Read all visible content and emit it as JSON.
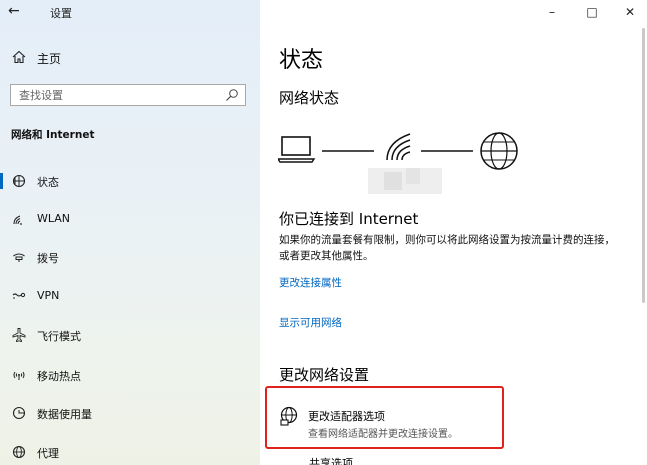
{
  "app": {
    "title": "设置"
  },
  "sidebar": {
    "home_label": "主页",
    "search_placeholder": "查找设置",
    "section_title": "网络和 Internet",
    "items": [
      {
        "label": "状态",
        "icon": "status-icon",
        "active": true
      },
      {
        "label": "WLAN",
        "icon": "wifi-icon",
        "active": false
      },
      {
        "label": "拨号",
        "icon": "dialup-icon",
        "active": false
      },
      {
        "label": "VPN",
        "icon": "vpn-icon",
        "active": false
      },
      {
        "label": "飞行模式",
        "icon": "airplane-icon",
        "active": false
      },
      {
        "label": "移动热点",
        "icon": "hotspot-icon",
        "active": false
      },
      {
        "label": "数据使用量",
        "icon": "data-usage-icon",
        "active": false
      },
      {
        "label": "代理",
        "icon": "globe-icon",
        "active": false
      }
    ]
  },
  "main": {
    "page_title": "状态",
    "network_status_heading": "网络状态",
    "connected_title": "你已连接到 Internet",
    "connected_desc": "如果你的流量套餐有限制，则你可以将此网络设置为按流量计费的连接，或者更改其他属性。",
    "link_change_props": "更改连接属性",
    "link_show_networks": "显示可用网络",
    "change_settings_heading": "更改网络设置",
    "adapter_title": "更改适配器选项",
    "adapter_desc": "查看网络适配器并更改连接设置。",
    "next_item_partial": "共享选项"
  },
  "colors": {
    "accent": "#0067c0",
    "highlight": "#e0221c"
  }
}
